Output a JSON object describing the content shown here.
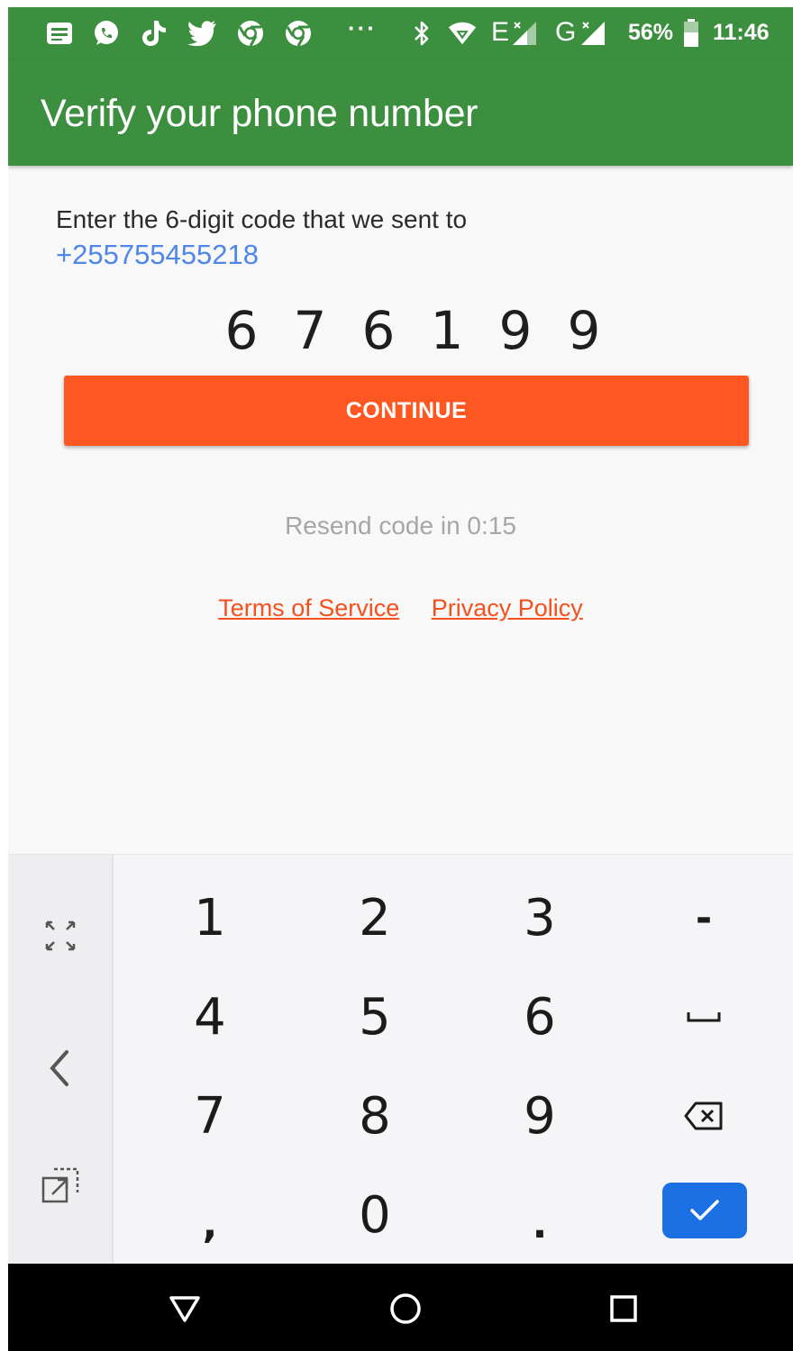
{
  "status_bar": {
    "icons": [
      "messages-icon",
      "whatsapp-icon",
      "tiktok-icon",
      "twitter-icon",
      "chrome-icon",
      "chrome-icon",
      "more-dots-icon",
      "bluetooth-icon",
      "wifi-icon",
      "signal-e-icon",
      "signal-g-icon",
      "battery-icon"
    ],
    "signal_1_label": "E",
    "signal_2_label": "G",
    "battery": "56%",
    "time": "11:46",
    "more": "···"
  },
  "app_bar": {
    "title": "Verify your phone number",
    "color": "#3c8f3e"
  },
  "verification": {
    "instruction": "Enter the 6-digit code that we sent to",
    "phone_number": "+255755455218",
    "code_digits": [
      "6",
      "7",
      "6",
      "1",
      "9",
      "9"
    ],
    "continue_label": "CONTINUE",
    "continue_color": "#ff5722",
    "resend_text": "Resend code in 0:15",
    "terms_label": "Terms of Service",
    "privacy_label": "Privacy Policy"
  },
  "keyboard": {
    "side_icons": [
      "expand-icon",
      "chevron-left-icon",
      "floating-keyboard-icon"
    ],
    "rows": [
      [
        "1",
        "2",
        "3",
        "-"
      ],
      [
        "4",
        "5",
        "6",
        "space-icon"
      ],
      [
        "7",
        "8",
        "9",
        "backspace-icon"
      ],
      [
        ",",
        "0",
        ".",
        "enter-check-icon"
      ]
    ],
    "enter_color": "#1d6fe4"
  },
  "nav_bar": {
    "icons": [
      "back-triangle-icon",
      "home-circle-icon",
      "recents-square-icon"
    ]
  }
}
